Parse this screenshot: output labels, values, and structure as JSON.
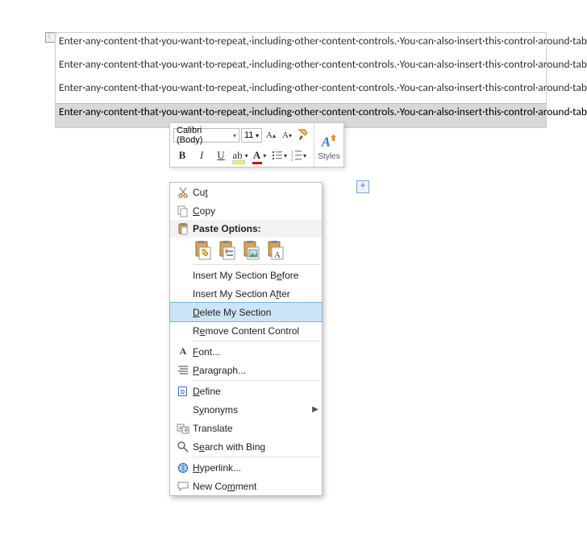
{
  "doc": {
    "paragraphs": [
      "Enter·any·content·that·you·want·to·repeat,·including·other·content·controls.·You·can·also·insert·this·control·around·table·rows·in·order·to·repeat·parts·of·a·table.¶",
      "Enter·any·content·that·you·want·to·repeat,·including·other·content·controls.·You·can·also·insert·this·control·around·table·rows·in·order·to·repeat·parts·of·a·table.¶",
      "Enter·any·content·that·you·want·to·repeat,·including·other·content·controls.·You·can·also·insert·this·control·around·table·rows·in·order·to·repeat·parts·of·a·table.¶",
      "Enter·any·content·that·you·want·to·repeat,·including·other·content·controls.·You·can·also·insert·this·control·around·table·rows·in·order·to·repeat·parts·of·a·table.¶"
    ]
  },
  "mini": {
    "font": "Calibri (Body)",
    "size": "11",
    "styles_label": "Styles"
  },
  "menu": {
    "cut": "Cut",
    "copy": "Copy",
    "paste_options": "Paste Options:",
    "insert_before": "Insert My Section Before",
    "insert_after": "Insert My Section After",
    "delete_section": "Delete My Section",
    "remove_cc": "Remove Content Control",
    "font": "Font...",
    "paragraph": "Paragraph...",
    "define": "Define",
    "synonyms": "Synonyms",
    "translate": "Translate",
    "search_bing": "Search with Bing",
    "hyperlink": "Hyperlink...",
    "new_comment": "New Comment"
  }
}
